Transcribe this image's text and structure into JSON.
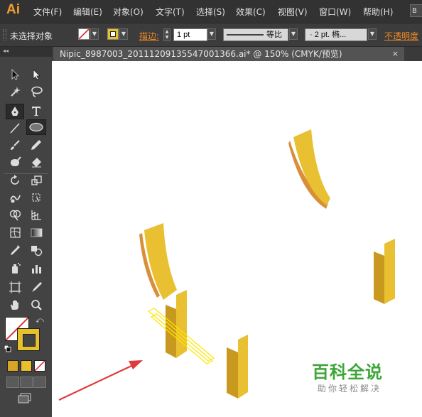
{
  "app": {
    "logo": "Ai"
  },
  "menu": [
    {
      "label": "文件(F)"
    },
    {
      "label": "编辑(E)"
    },
    {
      "label": "对象(O)"
    },
    {
      "label": "文字(T)"
    },
    {
      "label": "选择(S)"
    },
    {
      "label": "效果(C)"
    },
    {
      "label": "视图(V)"
    },
    {
      "label": "窗口(W)"
    },
    {
      "label": "帮助(H)"
    }
  ],
  "menu_overflow": "B",
  "control": {
    "selection_status": "未选择对象",
    "stroke_label": "描边:",
    "stroke_weight": "1 pt",
    "stroke_profile": "等比",
    "brush": "· 2 pt. 椭...",
    "opacity_label": "不透明度"
  },
  "document_tab": {
    "title": "Nipic_8987003_20111209135547001366.ai* @ 150% (CMYK/预览)",
    "close": "×"
  },
  "watermark": {
    "title": "百科全说",
    "subtitle": "助你轻松解决"
  },
  "colors": {
    "fill_swatch": "#e7c02c",
    "shape_light": "#e8c032",
    "shape_dark": "#c9981e",
    "shape_edge": "#d98f3a",
    "arrow": "#e03a3a",
    "highlight": "#ffe600"
  },
  "icons": [
    "selection-tool-icon",
    "direct-selection-tool-icon",
    "magic-wand-icon",
    "lasso-icon",
    "pen-tool-icon",
    "type-tool-icon",
    "line-tool-icon",
    "ellipse-tool-icon",
    "paintbrush-icon",
    "pencil-icon",
    "blob-brush-icon",
    "eraser-icon",
    "rotate-icon",
    "scale-icon",
    "warp-icon",
    "free-transform-icon",
    "shape-builder-icon",
    "perspective-grid-icon",
    "mesh-icon",
    "gradient-icon",
    "eyedropper-icon",
    "blend-icon",
    "symbol-sprayer-icon",
    "column-graph-icon",
    "artboard-icon",
    "slice-icon",
    "hand-icon",
    "zoom-icon"
  ]
}
